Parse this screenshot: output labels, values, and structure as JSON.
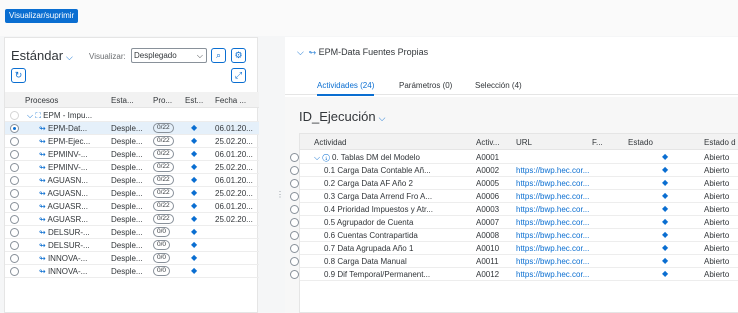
{
  "topbar": {
    "primary_button": "Visualizar/suprimir"
  },
  "left": {
    "variant": "Estándar",
    "visualizar_label": "Visualizar:",
    "visualizar_value": "Desplegado",
    "columns": [
      "Procesos",
      "Esta...",
      "Pro...",
      "Est...",
      "Fecha ..."
    ],
    "group_label": "EPM - Impu...",
    "rows": [
      {
        "proceso": "EPM-Dat...",
        "estado": "Desple...",
        "pro": "0/22",
        "fecha": "06.01.20...",
        "selected": true
      },
      {
        "proceso": "EPM-Ejec...",
        "estado": "Desple...",
        "pro": "0/22",
        "fecha": "25.02.20...",
        "selected": false
      },
      {
        "proceso": "EPMINV-...",
        "estado": "Desple...",
        "pro": "0/22",
        "fecha": "06.01.20...",
        "selected": false
      },
      {
        "proceso": "EPMINV-...",
        "estado": "Desple...",
        "pro": "0/22",
        "fecha": "25.02.20...",
        "selected": false
      },
      {
        "proceso": "AGUASN...",
        "estado": "Desple...",
        "pro": "0/22",
        "fecha": "06.01.20...",
        "selected": false
      },
      {
        "proceso": "AGUASN...",
        "estado": "Desple...",
        "pro": "0/22",
        "fecha": "25.02.20...",
        "selected": false
      },
      {
        "proceso": "AGUASR...",
        "estado": "Desple...",
        "pro": "0/22",
        "fecha": "06.01.20...",
        "selected": false
      },
      {
        "proceso": "AGUASR...",
        "estado": "Desple...",
        "pro": "0/22",
        "fecha": "25.02.20...",
        "selected": false
      },
      {
        "proceso": "DELSUR-...",
        "estado": "Desple...",
        "pro": "0/0",
        "fecha": "",
        "selected": false
      },
      {
        "proceso": "DELSUR-...",
        "estado": "Desple...",
        "pro": "0/0",
        "fecha": "",
        "selected": false
      },
      {
        "proceso": "INNOVA-...",
        "estado": "Desple...",
        "pro": "0/0",
        "fecha": "",
        "selected": false
      },
      {
        "proceso": "INNOVA-...",
        "estado": "Desple...",
        "pro": "0/0",
        "fecha": "",
        "selected": false
      }
    ]
  },
  "right": {
    "title": "EPM-Data Fuentes Propias",
    "tabs": [
      "Actividades (24)",
      "Parámetros (0)",
      "Selección (4)"
    ],
    "id_heading": "ID_Ejecución",
    "columns": [
      "Actividad",
      "Activ...",
      "URL",
      "F...",
      "Estado",
      "Estado d"
    ],
    "rows": [
      {
        "actividad": "0. Tablas DM del Modelo",
        "id": "A0001",
        "url": "",
        "estado_d": "Abierto",
        "group": true
      },
      {
        "actividad": "0.1 Carga Data Contable Añ...",
        "id": "A0002",
        "url": "https://bwp.hec.cor...",
        "estado_d": "Abierto",
        "group": false
      },
      {
        "actividad": "0.2 Carga Data AF Año 2",
        "id": "A0005",
        "url": "https://bwp.hec.cor...",
        "estado_d": "Abierto",
        "group": false
      },
      {
        "actividad": "0.3 Carga Data Arrend Fro A...",
        "id": "A0006",
        "url": "https://bwp.hec.cor...",
        "estado_d": "Abierto",
        "group": false
      },
      {
        "actividad": "0.4 Prioridad Impuestos y Atr...",
        "id": "A0003",
        "url": "https://bwp.hec.cor...",
        "estado_d": "Abierto",
        "group": false
      },
      {
        "actividad": "0.5 Agrupador de Cuenta",
        "id": "A0007",
        "url": "https://bwp.hec.cor...",
        "estado_d": "Abierto",
        "group": false
      },
      {
        "actividad": "0.6 Cuentas Contrapartida",
        "id": "A0008",
        "url": "https://bwp.hec.cor...",
        "estado_d": "Abierto",
        "group": false
      },
      {
        "actividad": "0.7 Data Agrupada Año 1",
        "id": "A0010",
        "url": "https://bwp.hec.cor...",
        "estado_d": "Abierto",
        "group": false
      },
      {
        "actividad": "0.8 Carga Data Manual",
        "id": "A0011",
        "url": "https://bwp.hec.cor...",
        "estado_d": "Abierto",
        "group": false
      },
      {
        "actividad": "0.9 Dif Temporal/Permanent...",
        "id": "A0012",
        "url": "https://bwp.hec.cor...",
        "estado_d": "Abierto",
        "group": false
      }
    ]
  },
  "colors": {
    "accent": "#0a6ed1",
    "selected_row": "#e5f0fa"
  }
}
